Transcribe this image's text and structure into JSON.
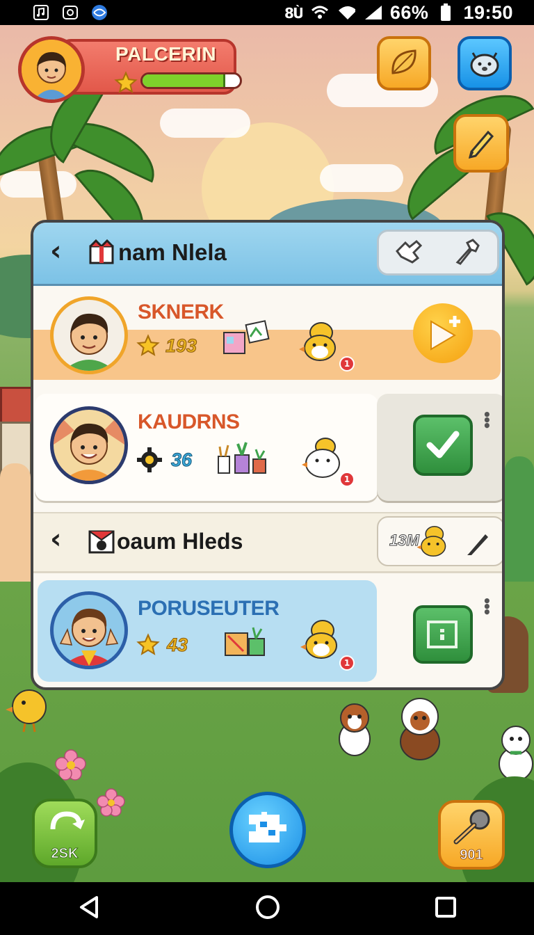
{
  "status_bar": {
    "left_icons": [
      "music-icon",
      "image-icon",
      "browser-icon"
    ],
    "battery_percent": "66%",
    "time": "19:50"
  },
  "player": {
    "name": "PALCERIN",
    "xp_fraction": 0.85
  },
  "panel": {
    "title": "nam Nlela",
    "section_title": "oaum Hleds",
    "section_badge": "13M"
  },
  "players": [
    {
      "name": "SKNERK",
      "score": "193",
      "name_color": "#d8572a",
      "notification": "1",
      "action": "play-plus"
    },
    {
      "name": "KAUDRNS",
      "score": "36",
      "name_color": "#d8572a",
      "notification": "1",
      "action": "check"
    },
    {
      "name": "PORUSEUTER",
      "score": "43",
      "name_color": "#2b6fb3",
      "notification": "1",
      "action": "locker"
    }
  ],
  "bottom": {
    "left_label": "2SK",
    "right_label": "901"
  },
  "colors": {
    "accent_red": "#e2584a",
    "accent_orange": "#f7a826",
    "accent_blue": "#1791e6",
    "accent_green": "#3fa34d"
  }
}
